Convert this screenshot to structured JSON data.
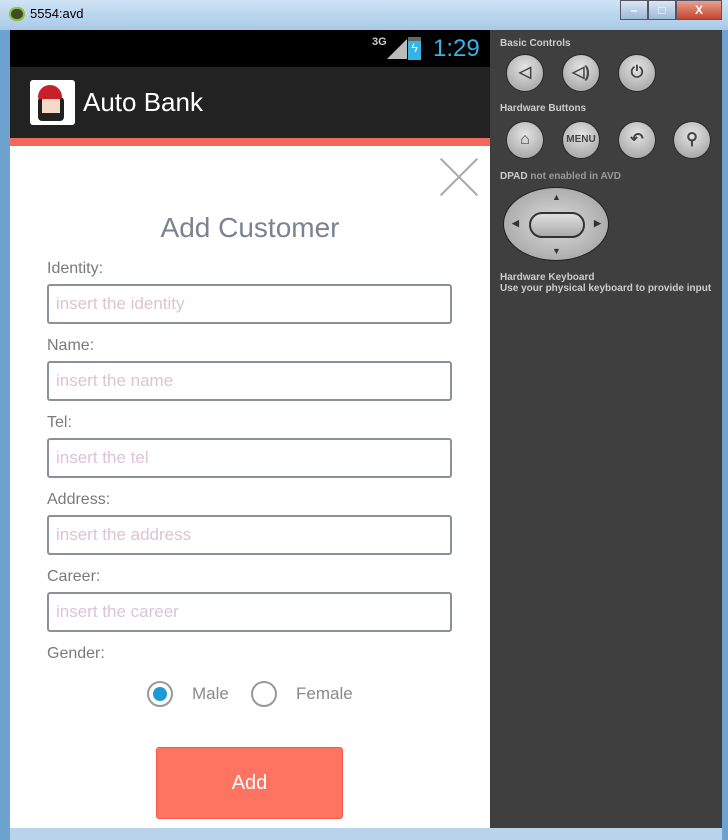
{
  "window": {
    "title": "5554:avd",
    "close_label": "X"
  },
  "statusbar": {
    "network": "3G",
    "time": "1:29"
  },
  "actionbar": {
    "title": "Auto Bank"
  },
  "form": {
    "title": "Add Customer",
    "fields": [
      {
        "label": "Identity:",
        "placeholder": "insert the identity",
        "value": ""
      },
      {
        "label": "Name:",
        "placeholder": "insert the name",
        "value": ""
      },
      {
        "label": "Tel:",
        "placeholder": "insert the tel",
        "value": ""
      },
      {
        "label": "Address:",
        "placeholder": "insert the address",
        "value": ""
      },
      {
        "label": "Career:",
        "placeholder": "insert the career",
        "value": ""
      }
    ],
    "gender_label": "Gender:",
    "gender_options": [
      {
        "label": "Male",
        "selected": true
      },
      {
        "label": "Female",
        "selected": false
      }
    ],
    "submit_label": "Add"
  },
  "panel": {
    "basic_controls": "Basic Controls",
    "hardware_buttons": "Hardware Buttons",
    "menu_label": "MENU",
    "dpad_title": "DPAD",
    "dpad_note": "not enabled in AVD",
    "keyboard_title": "Hardware Keyboard",
    "keyboard_note": "Use your physical keyboard to provide input"
  },
  "colors": {
    "accent": "#ff7461",
    "stripe": "#f0695a",
    "radio": "#1e9ad6",
    "clock": "#33b5e5"
  }
}
